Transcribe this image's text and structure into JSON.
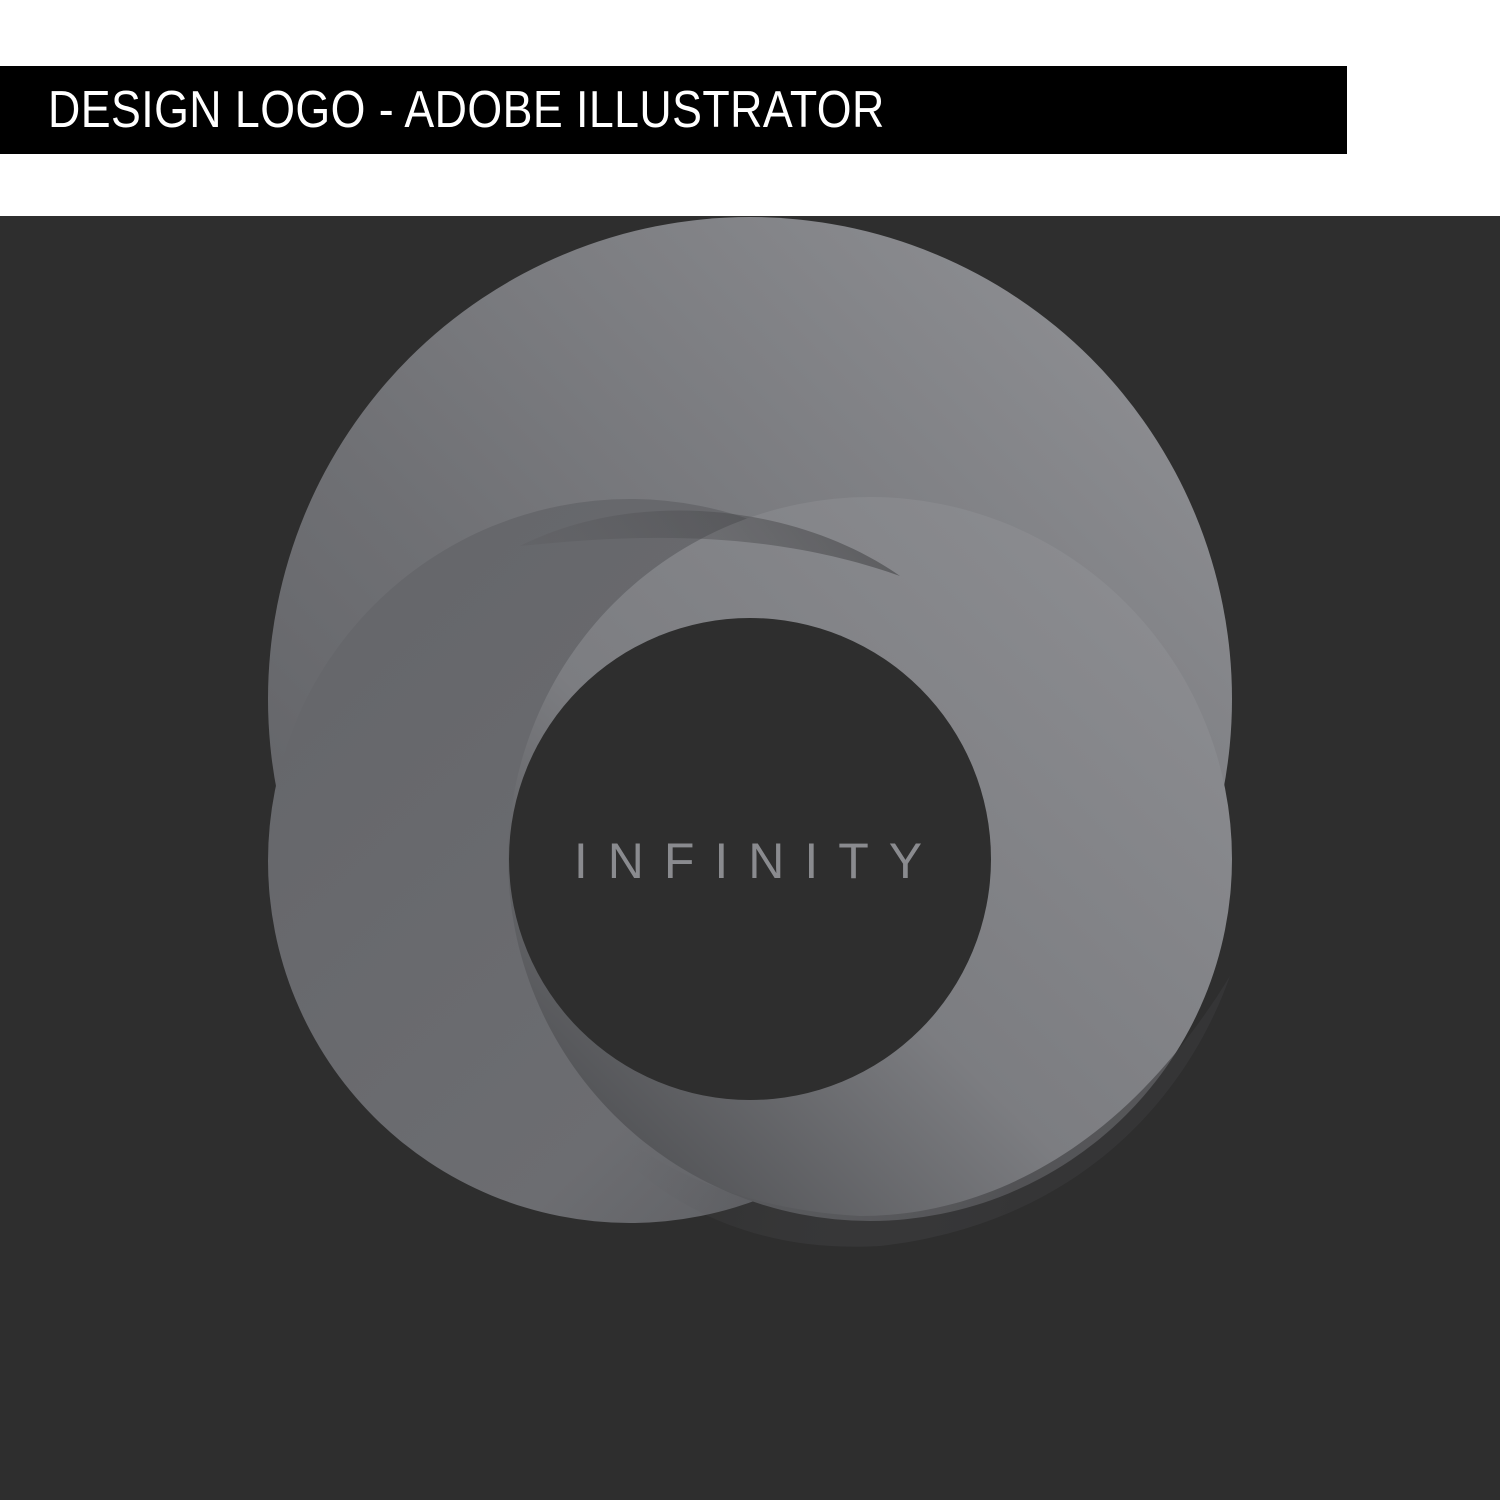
{
  "header": {
    "title": "DESIGN LOGO - ADOBE ILLUSTRATOR"
  },
  "logo": {
    "wordmark": "INFINITY",
    "icon": "infinity-ring-icon"
  },
  "colors": {
    "header_bar": "#000000",
    "header_text": "#ffffff",
    "artboard": "#2e2e2e",
    "ring_light": "#86878b",
    "ring_mid": "#6a6b6f",
    "ring_dark": "#3c3c3e",
    "wordmark": "#8a8b8f"
  }
}
